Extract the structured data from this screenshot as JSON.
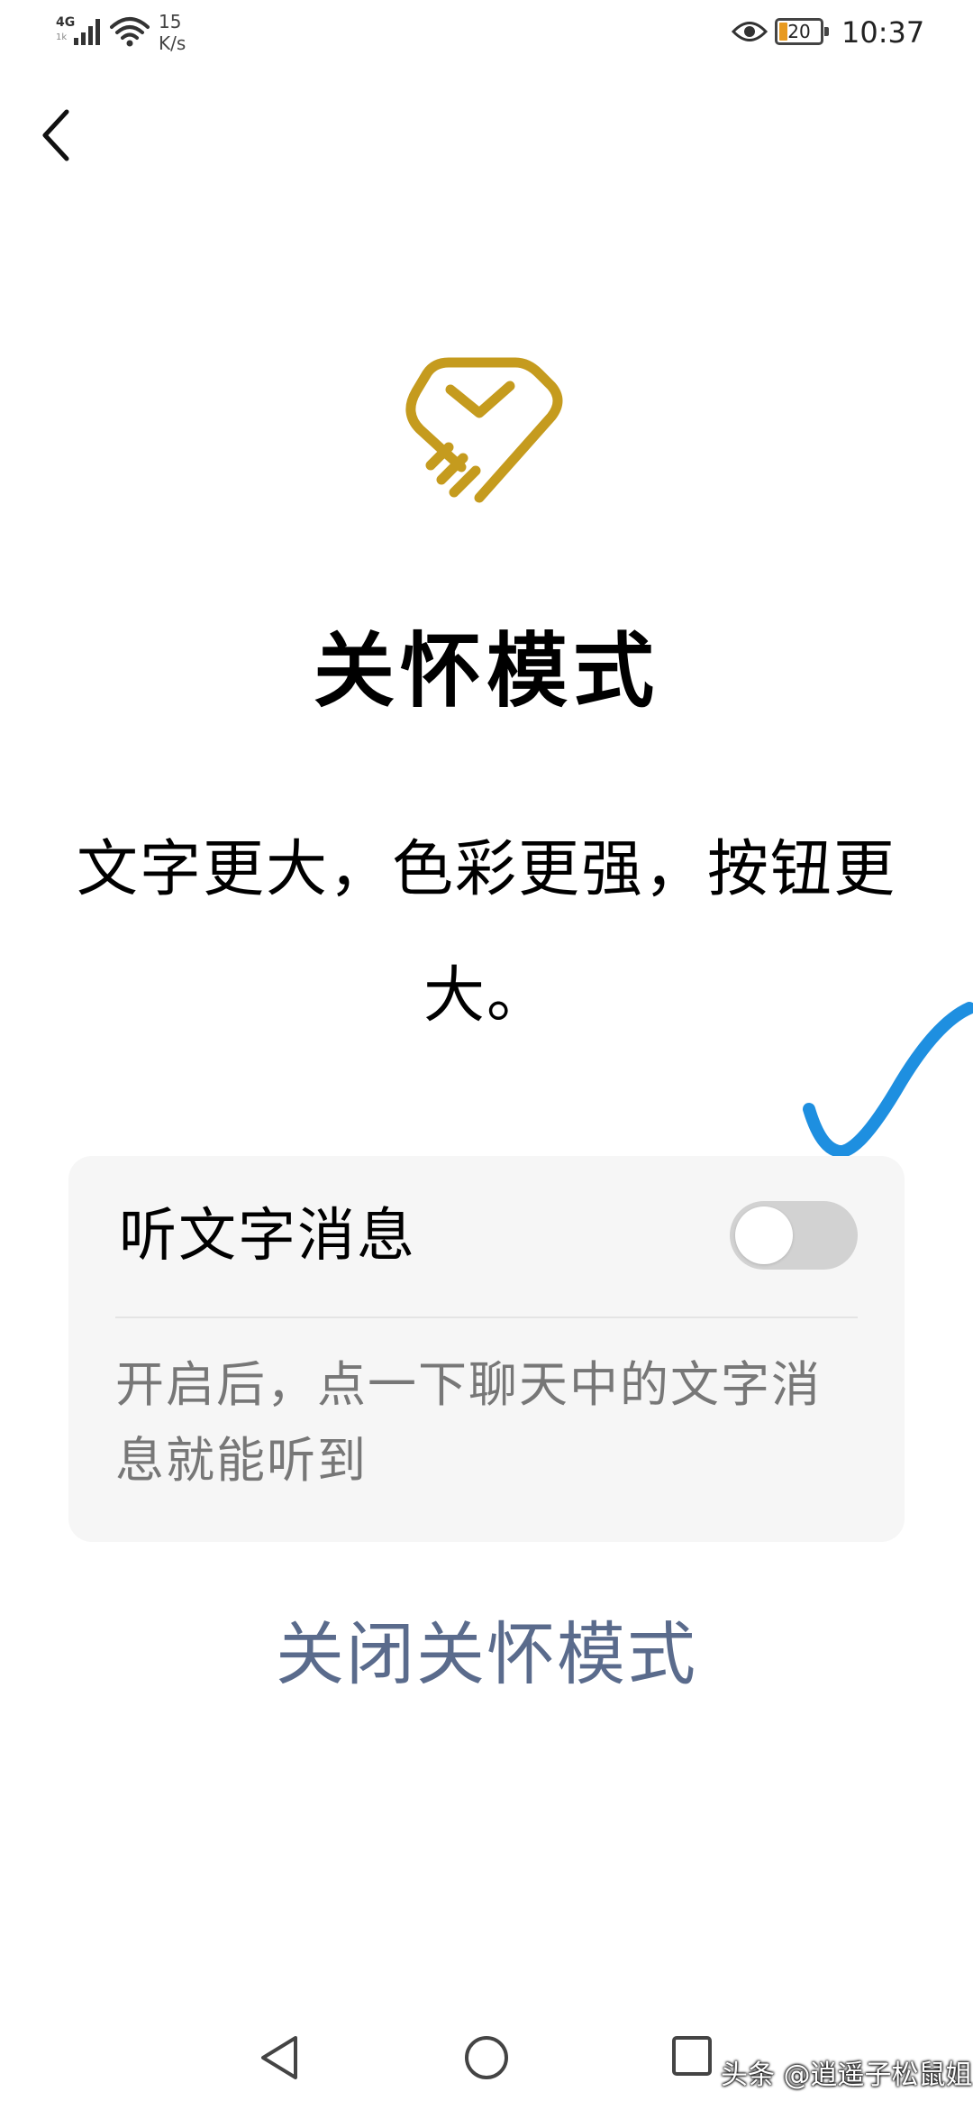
{
  "status_bar": {
    "network_type": "4G",
    "network_sub": "1k",
    "speed_value": "15",
    "speed_unit": "K/s",
    "battery_level": "20",
    "battery_fill_fraction": 0.2,
    "time": "10:37"
  },
  "icons": {
    "back": "chevron-left-icon",
    "logo": "heart-hands-icon",
    "eye": "eye-icon",
    "signal": "cellular-signal-icon",
    "wifi": "wifi-icon",
    "nav_back": "triangle-back-icon",
    "nav_home": "circle-home-icon",
    "nav_recents": "square-recents-icon"
  },
  "colors": {
    "logo_gold": "#c59b1e",
    "toggle_off": "#d2d2d2",
    "card_background": "#f6f6f6",
    "link_blue_gray": "#5a6b8c",
    "annotation_blue": "#1e8fe0"
  },
  "main": {
    "title": "关怀模式",
    "description": "文字更大，色彩更强，按钮更大。"
  },
  "settings_card": {
    "label": "听文字消息",
    "toggle_on": false,
    "hint": "开启后，点一下聊天中的文字消息就能听到"
  },
  "actions": {
    "close_care_mode": "关闭关怀模式"
  },
  "watermark": {
    "text": "头条 @逍遥子松鼠姐"
  }
}
